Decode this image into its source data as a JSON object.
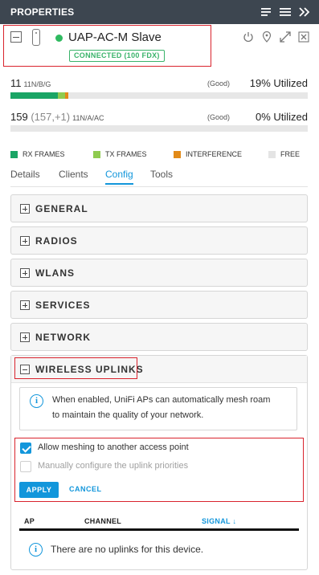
{
  "titlebar": {
    "title": "PROPERTIES",
    "icons": [
      "filter-lines-icon",
      "hamburger-menu-icon",
      "double-chevron-right-icon"
    ]
  },
  "device": {
    "name": "UAP-AC-M Slave",
    "status_badge": "CONNECTED (100 FDX)",
    "status_color": "#2fba60",
    "actions": [
      "power-restart-icon",
      "locate-pin-icon",
      "expand-icon",
      "close-icon"
    ]
  },
  "radios": [
    {
      "count": "11",
      "extra": "",
      "band": "11N/B/G",
      "quality": "(Good)",
      "utilization": "19% Utilized",
      "rx_fraction": 0.16,
      "tx_fraction": 0.023,
      "interference_fraction": 0.01
    },
    {
      "count": "159",
      "extra": "(157,+1)",
      "band": "11N/A/AC",
      "quality": "(Good)",
      "utilization": "0% Utilized",
      "rx_fraction": 0,
      "tx_fraction": 0,
      "interference_fraction": 0
    }
  ],
  "legend": [
    {
      "label": "RX FRAMES",
      "color": "#1aa565"
    },
    {
      "label": "TX FRAMES",
      "color": "#8fcb4f"
    },
    {
      "label": "INTERFERENCE",
      "color": "#e28a18"
    },
    {
      "label": "FREE",
      "color": "#e4e4e4"
    }
  ],
  "tabs": [
    {
      "label": "Details",
      "active": false
    },
    {
      "label": "Clients",
      "active": false
    },
    {
      "label": "Config",
      "active": true
    },
    {
      "label": "Tools",
      "active": false
    }
  ],
  "sections": [
    {
      "label": "GENERAL"
    },
    {
      "label": "RADIOS"
    },
    {
      "label": "WLANS"
    },
    {
      "label": "SERVICES"
    },
    {
      "label": "NETWORK"
    }
  ],
  "wireless_uplinks": {
    "label": "WIRELESS UPLINKS",
    "info": "When enabled, UniFi APs can automatically mesh roam to maintain the quality of your network.",
    "info_line1": "When enabled, UniFi APs can automatically mesh roam",
    "info_line2": "to maintain the quality of your network.",
    "allow_meshing_label": "Allow meshing to another access point",
    "allow_meshing_checked": true,
    "manual_priorities_label": "Manually configure the uplink priorities",
    "manual_priorities_checked": false,
    "apply_label": "APPLY",
    "cancel_label": "CANCEL",
    "table_headers": {
      "ap": "AP",
      "channel": "CHANNEL",
      "signal": "SIGNAL ↓"
    },
    "empty_message": "There are no uplinks for this device."
  },
  "colors": {
    "accent": "#1296db",
    "highlight_box": "#d9232d",
    "titlebar": "#3d4650"
  }
}
